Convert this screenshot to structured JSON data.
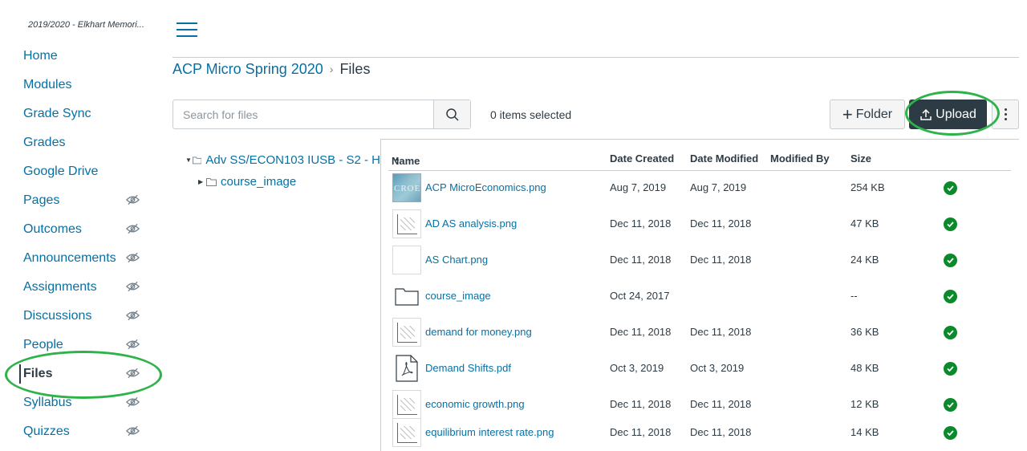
{
  "course_nav": {
    "term": "2019/2020 - Elkhart Memori...",
    "items": [
      {
        "label": "Home",
        "hidden": false
      },
      {
        "label": "Modules",
        "hidden": false
      },
      {
        "label": "Grade Sync",
        "hidden": false
      },
      {
        "label": "Grades",
        "hidden": false
      },
      {
        "label": "Google Drive",
        "hidden": false
      },
      {
        "label": "Pages",
        "hidden": true
      },
      {
        "label": "Outcomes",
        "hidden": true
      },
      {
        "label": "Announcements",
        "hidden": true
      },
      {
        "label": "Assignments",
        "hidden": true
      },
      {
        "label": "Discussions",
        "hidden": true
      },
      {
        "label": "People",
        "hidden": true
      },
      {
        "label": "Files",
        "hidden": true,
        "active": true
      },
      {
        "label": "Syllabus",
        "hidden": true
      },
      {
        "label": "Quizzes",
        "hidden": true
      }
    ]
  },
  "breadcrumb": {
    "course": "ACP Micro Spring 2020",
    "separator": "›",
    "current": "Files"
  },
  "toolbar": {
    "search_placeholder": "Search for files",
    "items_selected": "0 items selected",
    "folder_label": "Folder",
    "upload_label": "Upload"
  },
  "tree": {
    "root": "Adv SS/ECON103 IUSB - S2 - H",
    "child": "course_image"
  },
  "table": {
    "headers": {
      "name": "Name",
      "created": "Date Created",
      "modified": "Date Modified",
      "modified_by": "Modified By",
      "size": "Size"
    },
    "rows": [
      {
        "name": "ACP MicroEconomics.png",
        "created": "Aug 7, 2019",
        "modified": "Aug 7, 2019",
        "size": "254 KB",
        "thumb": "image-thumbnail",
        "thumb_text": "CROE"
      },
      {
        "name": "AD AS analysis.png",
        "created": "Dec 11, 2018",
        "modified": "Dec 11, 2018",
        "size": "47 KB",
        "thumb": "image-thumbnail"
      },
      {
        "name": "AS Chart.png",
        "created": "Dec 11, 2018",
        "modified": "Dec 11, 2018",
        "size": "24 KB",
        "thumb": "image-thumbnail"
      },
      {
        "name": "course_image",
        "created": "Oct 24, 2017",
        "modified": "",
        "size": "--",
        "thumb": "folder-icon"
      },
      {
        "name": "demand for money.png",
        "created": "Dec 11, 2018",
        "modified": "Dec 11, 2018",
        "size": "36 KB",
        "thumb": "image-thumbnail"
      },
      {
        "name": "Demand Shifts.pdf",
        "created": "Oct 3, 2019",
        "modified": "Oct 3, 2019",
        "size": "48 KB",
        "thumb": "pdf-icon"
      },
      {
        "name": "economic growth.png",
        "created": "Dec 11, 2018",
        "modified": "Dec 11, 2018",
        "size": "12 KB",
        "thumb": "image-thumbnail"
      },
      {
        "name": "equilibrium interest rate.png",
        "created": "Dec 11, 2018",
        "modified": "Dec 11, 2018",
        "size": "14 KB",
        "thumb": "image-thumbnail"
      }
    ]
  },
  "colors": {
    "link": "#0770a3",
    "text": "#2d3b45",
    "upload_button": "#2d3b45",
    "published": "#0b8a2c",
    "annotation": "#2db34a"
  }
}
